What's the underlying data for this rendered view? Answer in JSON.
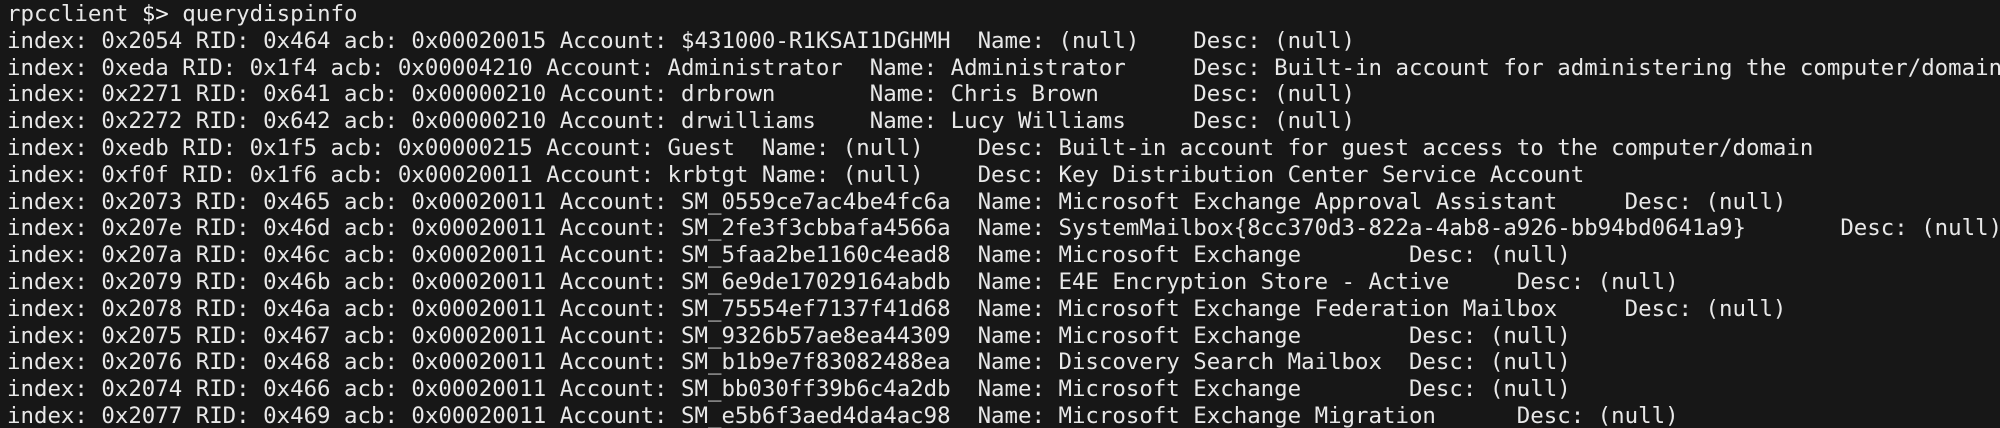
{
  "terminal": {
    "prompt": {
      "host": "rpcclient",
      "symbol": "$>",
      "command": "querydispinfo"
    },
    "lines": [
      "index: 0x2054 RID: 0x464 acb: 0x00020015 Account: $431000-R1KSAI1DGHMH  Name: (null)    Desc: (null)",
      "index: 0xeda RID: 0x1f4 acb: 0x00004210 Account: Administrator  Name: Administrator     Desc: Built-in account for administering the computer/domain",
      "index: 0x2271 RID: 0x641 acb: 0x00000210 Account: drbrown       Name: Chris Brown       Desc: (null)",
      "index: 0x2272 RID: 0x642 acb: 0x00000210 Account: drwilliams    Name: Lucy Williams     Desc: (null)",
      "index: 0xedb RID: 0x1f5 acb: 0x00000215 Account: Guest  Name: (null)    Desc: Built-in account for guest access to the computer/domain",
      "index: 0xf0f RID: 0x1f6 acb: 0x00020011 Account: krbtgt Name: (null)    Desc: Key Distribution Center Service Account",
      "index: 0x2073 RID: 0x465 acb: 0x00020011 Account: SM_0559ce7ac4be4fc6a  Name: Microsoft Exchange Approval Assistant     Desc: (null)",
      "index: 0x207e RID: 0x46d acb: 0x00020011 Account: SM_2fe3f3cbbafa4566a  Name: SystemMailbox{8cc370d3-822a-4ab8-a926-bb94bd0641a9}       Desc: (null)",
      "index: 0x207a RID: 0x46c acb: 0x00020011 Account: SM_5faa2be1160c4ead8  Name: Microsoft Exchange        Desc: (null)",
      "index: 0x2079 RID: 0x46b acb: 0x00020011 Account: SM_6e9de17029164abdb  Name: E4E Encryption Store - Active     Desc: (null)",
      "index: 0x2078 RID: 0x46a acb: 0x00020011 Account: SM_75554ef7137f41d68  Name: Microsoft Exchange Federation Mailbox     Desc: (null)",
      "index: 0x2075 RID: 0x467 acb: 0x00020011 Account: SM_9326b57ae8ea44309  Name: Microsoft Exchange        Desc: (null)",
      "index: 0x2076 RID: 0x468 acb: 0x00020011 Account: SM_b1b9e7f83082488ea  Name: Discovery Search Mailbox  Desc: (null)",
      "index: 0x2074 RID: 0x466 acb: 0x00020011 Account: SM_bb030ff39b6c4a2db  Name: Microsoft Exchange        Desc: (null)",
      "index: 0x2077 RID: 0x469 acb: 0x00020011 Account: SM_e5b6f3aed4da4ac98  Name: Microsoft Exchange Migration      Desc: (null)"
    ]
  }
}
